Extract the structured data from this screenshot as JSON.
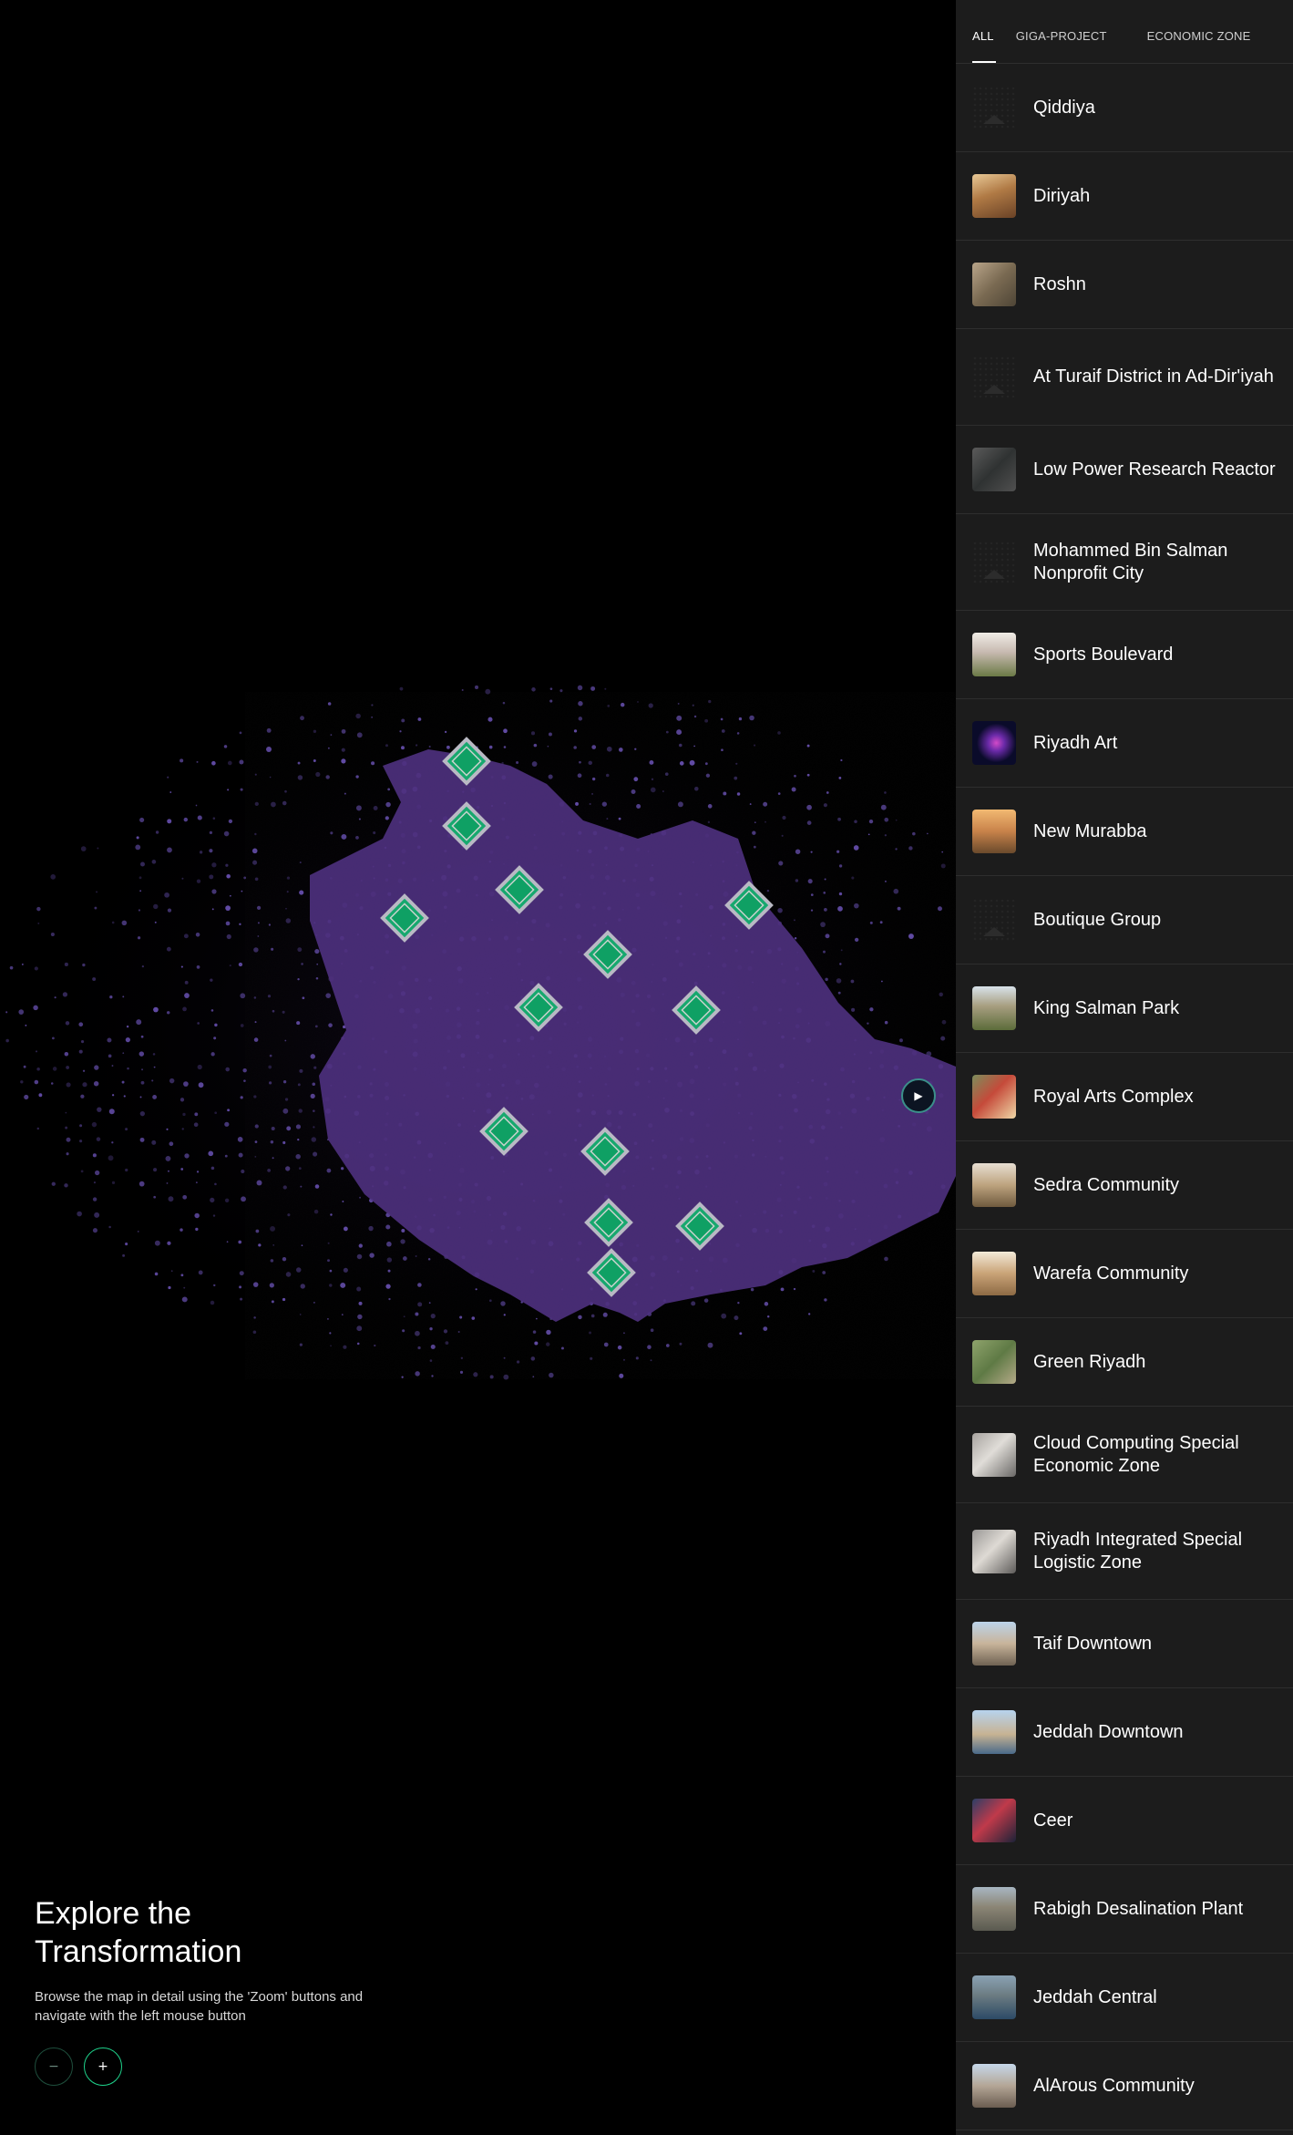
{
  "colors": {
    "background": "#000000",
    "panel": "#1c1c1c",
    "map_region": "#4a2c7a",
    "marker_green": "#16a86e",
    "marker_border": "#b9b9c4",
    "accent_green": "#1ed18a"
  },
  "tabs": [
    {
      "label": "ALL",
      "active": true
    },
    {
      "label": "GIGA-PROJECT",
      "active": false
    },
    {
      "label": "ECONOMIC ZONE",
      "active": false
    }
  ],
  "projects": [
    {
      "label": "Qiddiya",
      "thumb": "placeholder"
    },
    {
      "label": "Diriyah",
      "thumb": "linear-gradient(160deg,#e8c997,#b07a45 45%,#6a4226)"
    },
    {
      "label": "Roshn",
      "thumb": "linear-gradient(135deg,#b9a58a,#7a6a52 50%,#4e4536)"
    },
    {
      "label": "At Turaif District in Ad-Dir'iyah",
      "thumb": "placeholder"
    },
    {
      "label": "Low Power Research Reactor",
      "thumb": "linear-gradient(135deg,#5b5b5b,#2f3232 50%,#505050)"
    },
    {
      "label": "Mohammed Bin Salman Nonprofit City",
      "thumb": "placeholder"
    },
    {
      "label": "Sports Boulevard",
      "thumb": "linear-gradient(180deg,#f0ece6,#c7b9b0 45%,#6b7a46)"
    },
    {
      "label": "Riyadh Art",
      "thumb": "radial-gradient(circle at 55% 50%,#d24ac8 0,#6a2aa8 25%,#0a0b2a 60%)"
    },
    {
      "label": "New Murabba",
      "thumb": "linear-gradient(180deg,#f2b972,#c8824a 50%,#6a4a2c)"
    },
    {
      "label": "Boutique Group",
      "thumb": "placeholder"
    },
    {
      "label": "King Salman Park",
      "thumb": "linear-gradient(180deg,#d8e2ea,#a79e80 45%,#5c6c3a)"
    },
    {
      "label": "Royal Arts Complex",
      "thumb": "linear-gradient(135deg,#7c8e5c,#c54a3a 45%,#efd7a6)"
    },
    {
      "label": "Sedra Community",
      "thumb": "linear-gradient(180deg,#e7ded2,#bda37e 50%,#6f5a3e)"
    },
    {
      "label": "Warefa Community",
      "thumb": "linear-gradient(180deg,#f3ead8,#c9a377 50%,#8d6a44)"
    },
    {
      "label": "Green Riyadh",
      "thumb": "linear-gradient(135deg,#8fa36c,#5f7a45 50%,#b4aa88)"
    },
    {
      "label": "Cloud Computing Special Economic Zone",
      "thumb": "linear-gradient(135deg,#a6a29e,#e0ddd8 45%,#6a6866)"
    },
    {
      "label": "Riyadh Integrated Special Logistic Zone",
      "thumb": "linear-gradient(135deg,#9a9896,#dedad4 45%,#5e5c5a)"
    },
    {
      "label": "Taif Downtown",
      "thumb": "linear-gradient(180deg,#bcd4ea,#c8b49a 50%,#6f6252)"
    },
    {
      "label": "Jeddah Downtown",
      "thumb": "linear-gradient(180deg,#b7d3ee,#c7b393 55%,#4a6a8a)"
    },
    {
      "label": "Ceer",
      "thumb": "linear-gradient(135deg,#2c3e66,#c03a4a 45%,#1c2238)"
    },
    {
      "label": "Rabigh Desalination Plant",
      "thumb": "linear-gradient(180deg,#a8b6c2,#8c8676 45%,#5a5a50)"
    },
    {
      "label": "Jeddah Central",
      "thumb": "linear-gradient(180deg,#8aa2b4,#6c7c82 45%,#2c4a66)"
    },
    {
      "label": "AlArous Community",
      "thumb": "linear-gradient(180deg,#c6d8ea,#b4a696 50%,#6a5c50)"
    }
  ],
  "explore": {
    "title": "Explore the Transformation",
    "description": "Browse the map in detail using the 'Zoom' buttons and navigate with the left mouse button"
  },
  "zoom": {
    "minus_label": "−",
    "plus_label": "+"
  },
  "next_icon": "play-arrow-icon",
  "map_marker_count": 14
}
